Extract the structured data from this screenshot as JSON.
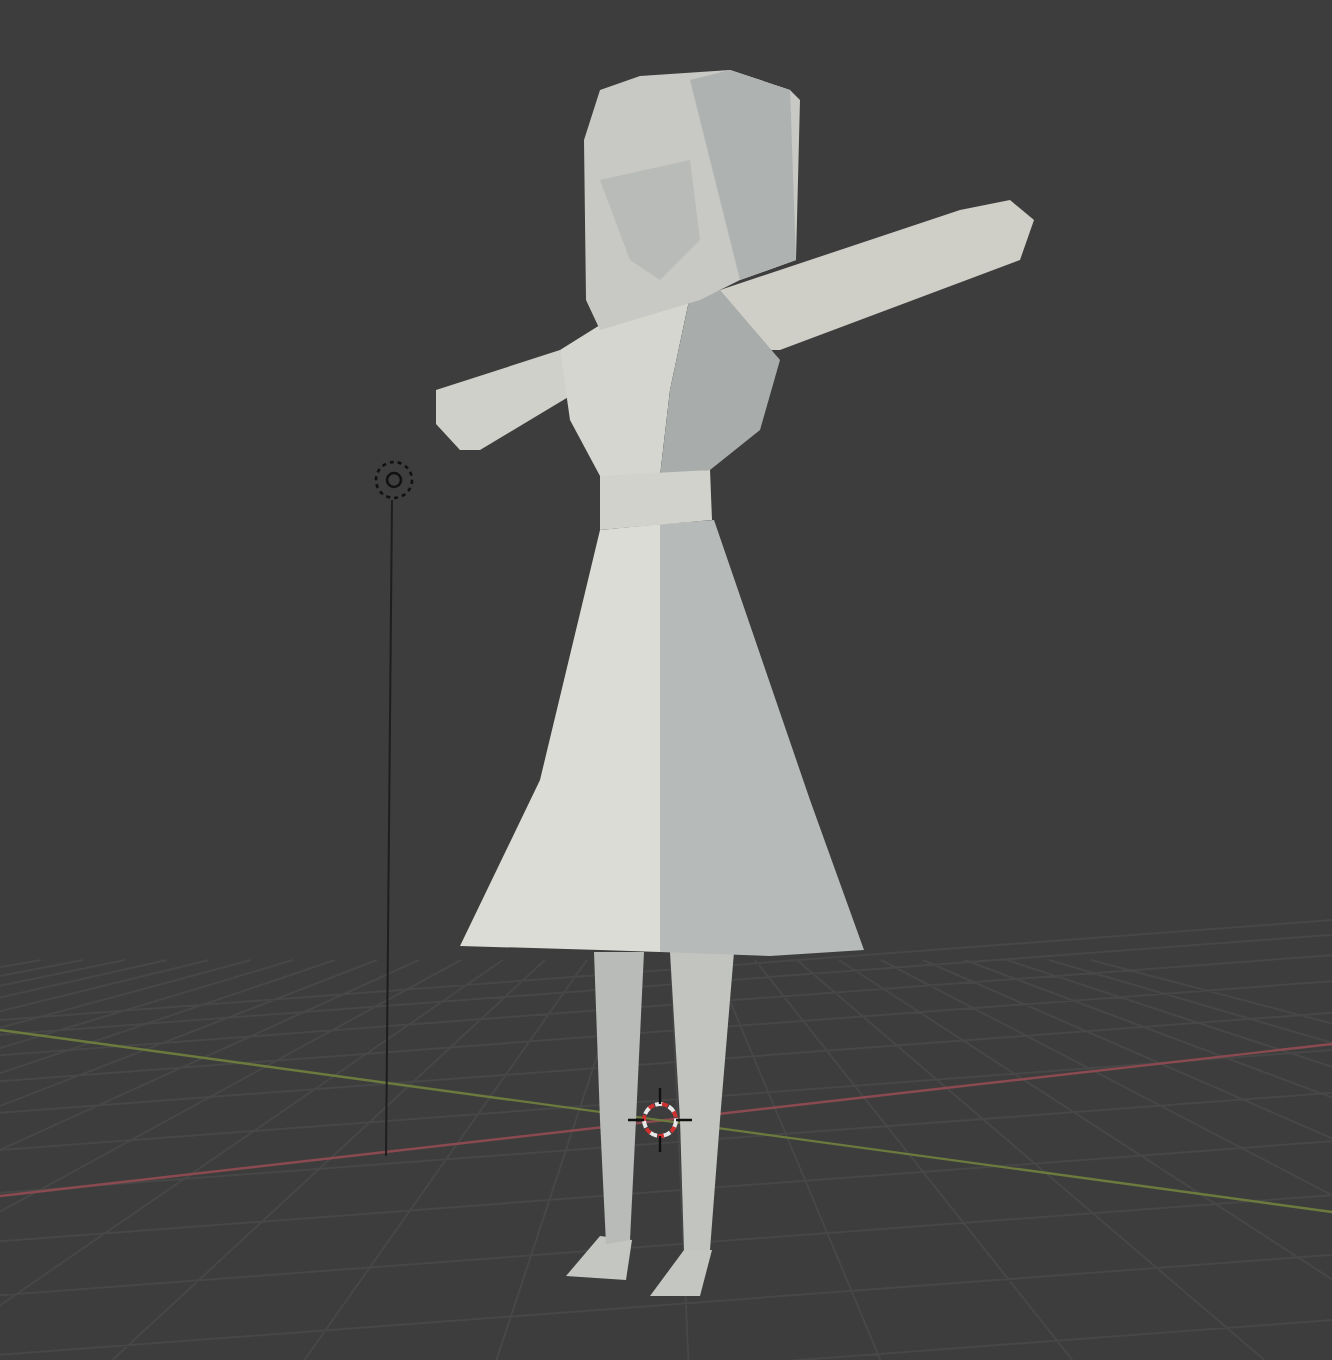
{
  "viewport": {
    "floor_grid": true,
    "x_axis": true,
    "y_axis": true,
    "light": true,
    "cursor_3d": true
  }
}
